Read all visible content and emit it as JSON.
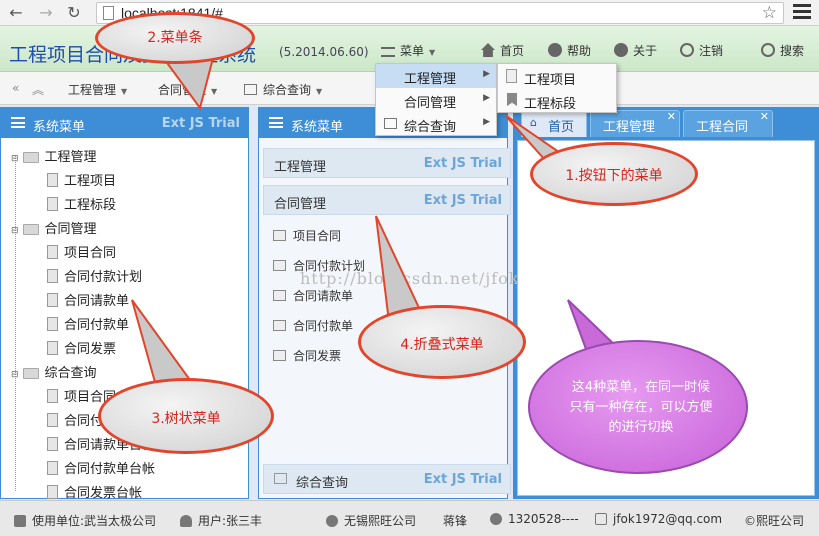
{
  "browser": {
    "url": "localhost:1841/#"
  },
  "header": {
    "title": "工程项目合同及资金管理系统",
    "version": "(5.2014.06.60)",
    "buttons": {
      "menu": "菜单",
      "home": "首页",
      "help": "帮助",
      "about": "关于",
      "logout": "注销",
      "search": "搜索"
    }
  },
  "toolbar": {
    "items": [
      "工程管理",
      "合同管理",
      "综合查询"
    ]
  },
  "dropdown": {
    "main": [
      "工程管理",
      "合同管理",
      "综合查询"
    ],
    "sub": [
      "工程项目",
      "工程标段"
    ]
  },
  "tree_panel": {
    "title": "系统菜单",
    "trial": "Ext JS Trial",
    "nodes": [
      {
        "label": "工程管理",
        "children": [
          "工程项目",
          "工程标段"
        ]
      },
      {
        "label": "合同管理",
        "children": [
          "项目合同",
          "合同付款计划",
          "合同请款单",
          "合同付款单",
          "合同发票"
        ]
      },
      {
        "label": "综合查询",
        "children": [
          "项目合同台帐",
          "合同付款计划台帐",
          "合同请款单台帐",
          "合同付款单台帐",
          "合同发票台帐"
        ]
      }
    ]
  },
  "accordion_panel": {
    "title": "系统菜单",
    "sections": [
      {
        "title": "工程管理",
        "trial": "Ext JS Trial"
      },
      {
        "title": "合同管理",
        "trial": "Ext JS Trial",
        "items": [
          "项目合同",
          "合同付款计划",
          "合同请款单",
          "合同付款单",
          "合同发票"
        ]
      },
      {
        "title": "综合查询",
        "trial": "Ext JS Trial"
      }
    ]
  },
  "tabs": [
    "首页",
    "工程管理",
    "工程合同"
  ],
  "annotations": {
    "a1": "1.按钮下的菜单",
    "a2": "2.菜单条",
    "a3": "3.树状菜单",
    "a4": "4.折叠式菜单",
    "note": "这4种菜单，在同一时候只有一种存在，可以方便的进行切换"
  },
  "watermark": "http://blog.csdn.net/jfok",
  "footer": {
    "unit": "使用单位:武当太极公司",
    "user": "用户:张三丰",
    "company": "无锡熙旺公司",
    "person": "蒋锋",
    "phone": "1320528----",
    "email": "jfok1972@qq.com",
    "copyright": "©熙旺公司"
  }
}
